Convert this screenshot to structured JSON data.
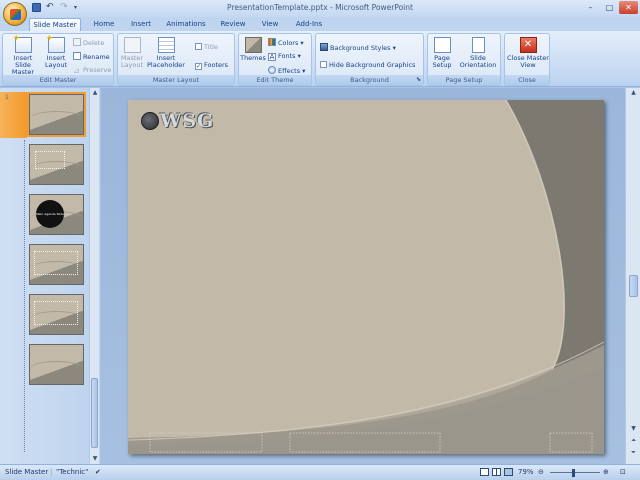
{
  "window": {
    "title": "PresentationTemplate.pptx - Microsoft PowerPoint",
    "minimize": "–",
    "maximize": "□",
    "close": "✕"
  },
  "tabs": [
    "Slide Master",
    "Home",
    "Insert",
    "Animations",
    "Review",
    "View",
    "Add-Ins"
  ],
  "ribbon": {
    "edit_master": {
      "label": "Edit Master",
      "insert_slide_master": "Insert Slide Master",
      "insert_layout": "Insert Layout",
      "delete": "Delete",
      "rename": "Rename",
      "preserve": "Preserve"
    },
    "master_layout": {
      "label": "Master Layout",
      "master_layout_btn": "Master Layout",
      "insert_placeholder": "Insert Placeholder",
      "title_checkbox": "Title",
      "footers_checkbox": "Footers",
      "title_checked": false,
      "footers_checked": true
    },
    "edit_theme": {
      "label": "Edit Theme",
      "themes": "Themes",
      "colors": "Colors",
      "fonts": "Fonts",
      "effects": "Effects"
    },
    "background": {
      "label": "Background",
      "background_styles": "Background Styles",
      "hide_background_graphics": "Hide Background Graphics",
      "hide_checked": false
    },
    "page_setup": {
      "label": "Page Setup",
      "page_setup_btn": "Page Setup",
      "slide_orientation": "Slide Orientation"
    },
    "close": {
      "label": "Close",
      "close_master_view": "Close Master View"
    }
  },
  "thumbnails": {
    "first_number": "1",
    "count": 6,
    "selected_index": 0,
    "thumb3_text": "Main Agenda Slide"
  },
  "slide": {
    "logo_text": "WSG"
  },
  "status": {
    "view": "Slide Master",
    "theme": "\"Technic\"",
    "zoom": "79%"
  },
  "colors": {
    "slide_light": "#c2b9a8",
    "slide_dark": "#7c7a72",
    "accent_orange": "#f39a2a",
    "ribbon_text": "#15428b"
  }
}
